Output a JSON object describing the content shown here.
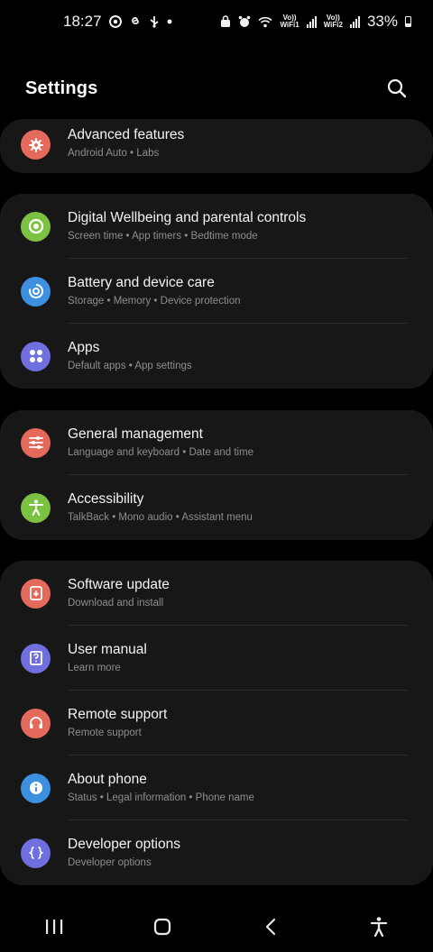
{
  "status_bar": {
    "time": "18:27",
    "sim1_label": "VoLTE WIFI1",
    "sim1_top": "Vo))",
    "sim1_bottom": "WiFi1",
    "sim2_top": "Vo))",
    "sim2_bottom": "WiFi2",
    "battery": "33%"
  },
  "header": {
    "title": "Settings"
  },
  "groups": [
    {
      "items": [
        {
          "title": "Advanced features",
          "subtitle": "Android Auto  •  Labs",
          "icon": "gear-plus-icon",
          "color": "#e56a5c"
        }
      ]
    },
    {
      "items": [
        {
          "title": "Digital Wellbeing and parental controls",
          "subtitle": "Screen time  •  App timers  •  Bedtime mode",
          "icon": "wellbeing-icon",
          "color": "#7cc242"
        },
        {
          "title": "Battery and device care",
          "subtitle": "Storage  •  Memory  •  Device protection",
          "icon": "device-care-icon",
          "color": "#3d8fe0"
        },
        {
          "title": "Apps",
          "subtitle": "Default apps  •  App settings",
          "icon": "apps-icon",
          "color": "#6f6fe0"
        }
      ]
    },
    {
      "items": [
        {
          "title": "General management",
          "subtitle": "Language and keyboard  •  Date and time",
          "icon": "sliders-icon",
          "color": "#e56a5c"
        },
        {
          "title": "Accessibility",
          "subtitle": "TalkBack  •  Mono audio  •  Assistant menu",
          "icon": "accessibility-icon",
          "color": "#7cc242"
        }
      ]
    },
    {
      "items": [
        {
          "title": "Software update",
          "subtitle": "Download and install",
          "icon": "software-update-icon",
          "color": "#e56a5c"
        },
        {
          "title": "User manual",
          "subtitle": "Learn more",
          "icon": "user-manual-icon",
          "color": "#6f6fe0"
        },
        {
          "title": "Remote support",
          "subtitle": "Remote support",
          "icon": "headset-icon",
          "color": "#e56a5c"
        },
        {
          "title": "About phone",
          "subtitle": "Status  •  Legal information  •  Phone name",
          "icon": "info-icon",
          "color": "#3d8fe0"
        },
        {
          "title": "Developer options",
          "subtitle": "Developer options",
          "icon": "developer-braces-icon",
          "color": "#6f6fe0"
        }
      ]
    }
  ],
  "nav_bar": {
    "recents": "recents-icon",
    "home": "home-icon",
    "back": "back-icon",
    "accessibility": "accessibility-shortcut-icon"
  }
}
